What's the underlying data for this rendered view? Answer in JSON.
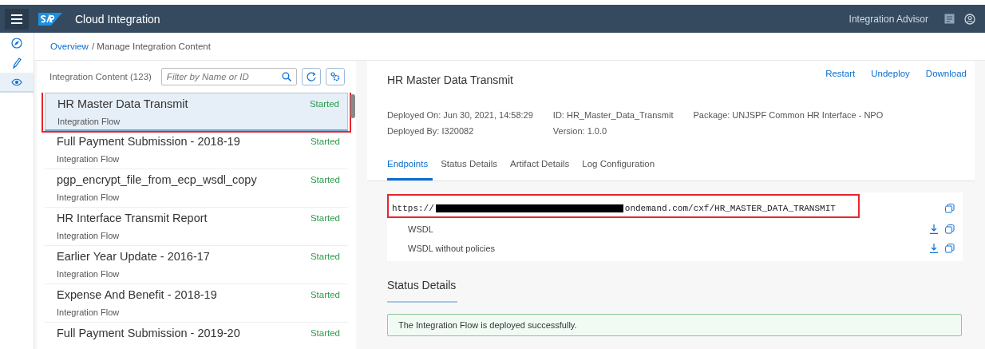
{
  "shell": {
    "product": "Cloud Integration",
    "advisor": "Integration Advisor"
  },
  "nav": [
    {
      "kind": "discover",
      "selected": false
    },
    {
      "kind": "design",
      "selected": false
    },
    {
      "kind": "monitor",
      "selected": true
    }
  ],
  "breadcrumb": {
    "link": "Overview",
    "current": "/ Manage Integration Content"
  },
  "list": {
    "title": "Integration Content (123)",
    "filter": {
      "placeholder": "Filter by Name or ID"
    },
    "items": [
      {
        "name": "HR Master Data Transmit",
        "type": "Integration Flow",
        "status": "Started",
        "selected": true,
        "highlighted": true
      },
      {
        "name": "Full Payment Submission - 2018-19",
        "type": "Integration Flow",
        "status": "Started",
        "selected": false,
        "highlighted": false
      },
      {
        "name": "pgp_encrypt_file_from_ecp_wsdl_copy",
        "type": "Integration Flow",
        "status": "Started",
        "selected": false,
        "highlighted": false
      },
      {
        "name": "HR Interface Transmit Report",
        "type": "Integration Flow",
        "status": "Started",
        "selected": false,
        "highlighted": false
      },
      {
        "name": "Earlier Year Update - 2016-17",
        "type": "Integration Flow",
        "status": "Started",
        "selected": false,
        "highlighted": false
      },
      {
        "name": "Expense And Benefit - 2018-19",
        "type": "Integration Flow",
        "status": "Started",
        "selected": false,
        "highlighted": false
      },
      {
        "name": "Full Payment Submission - 2019-20",
        "status": "Started",
        "selected": false,
        "highlighted": false
      }
    ]
  },
  "detail": {
    "title": "HR Master Data Transmit",
    "actions": [
      "Restart",
      "Undeploy",
      "Download"
    ],
    "facts": [
      [
        "Deployed On: Jun 30, 2021, 14:58:29",
        "Deployed By: I320082"
      ],
      [
        "ID: HR_Master_Data_Transmit",
        "Version: 1.0.0"
      ],
      [
        "Package: UNJSPF Common HR Interface - NPO"
      ]
    ],
    "tabs": [
      {
        "label": "Endpoints",
        "selected": true
      },
      {
        "label": "Status Details",
        "selected": false
      },
      {
        "label": "Artifact Details",
        "selected": false
      },
      {
        "label": "Log Configuration",
        "selected": false
      }
    ],
    "endpoint": {
      "prefix": "https://",
      "redacted": true,
      "suffix": "ondemand.com/cxf/HR_MASTER_DATA_TRANSMIT",
      "highlighted": true,
      "links": [
        {
          "label": "WSDL"
        },
        {
          "label": "WSDL without policies"
        }
      ]
    },
    "status_title": "Status Details",
    "status_message": "The Integration Flow is deployed successfully."
  }
}
